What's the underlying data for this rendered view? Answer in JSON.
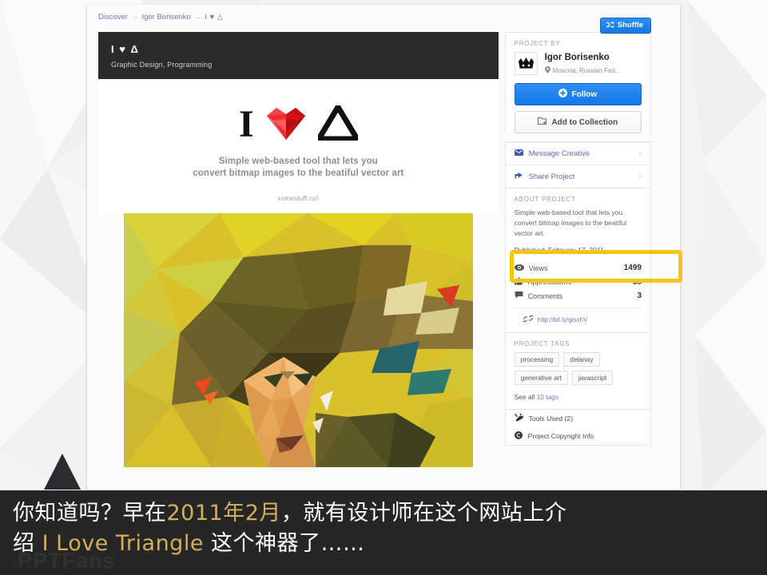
{
  "breadcrumb": {
    "item1": "Discover",
    "sep": "→",
    "item2": "Igor Borisenko",
    "current": "I ♥ △"
  },
  "topbar": {
    "shuffle_label": "Shuffle",
    "shuffle_icon": "shuffle-icon"
  },
  "project": {
    "title": "I ♥ Δ",
    "subtitle": "Graphic Design, Programming"
  },
  "hero": {
    "logo_letter": "I",
    "heart_icon": "faceted-heart-icon",
    "triangle_icon": "triangle-icon",
    "tagline_line1": "Simple web-based tool that lets you",
    "tagline_line2": "convert bitmap images to the beatiful vector art",
    "link": "somestuff.ru/i"
  },
  "sidebar": {
    "project_by_label": "PROJECT BY",
    "author_name": "Igor Borisenko",
    "author_location": "Moscow, Russian Fed...",
    "avatar_icon": "crown-avatar-icon",
    "location_icon": "map-pin-icon",
    "follow_label": "Follow",
    "follow_icon": "plus-circle-icon",
    "collection_label": "Add to Collection",
    "collection_icon": "add-folder-icon",
    "message_label": "Message Creative",
    "message_icon": "envelope-icon",
    "share_label": "Share Project",
    "share_icon": "share-icon",
    "chevron_icon": "chevron-right-icon",
    "about_label": "ABOUT PROJECT",
    "about_line1": "Simple web-based tool that lets you",
    "about_line2": "convert bitmap images to the beatiful",
    "about_line3": "vector art.",
    "published": "Published: February 17, 2011",
    "stats": [
      {
        "label": "Views",
        "value": "1499",
        "icon": "eye-icon"
      },
      {
        "label": "Appreciations",
        "value": "68",
        "icon": "thumbs-up-icon"
      },
      {
        "label": "Comments",
        "value": "3",
        "icon": "comment-icon"
      }
    ],
    "external_link": "http://bit.ly/gisxhV",
    "link_icon": "chain-link-icon",
    "tags_label": "PROJECT TAGS",
    "tags": [
      "processing",
      "delanay",
      "generative art",
      "javascript"
    ],
    "see_all_prefix": "See all ",
    "see_all_link": "10 tags",
    "tools_used": "Tools Used (2)",
    "tools_icon": "tools-icon",
    "copyright": "Project Copyright Info",
    "copyright_icon": "copyright-icon"
  },
  "annotation": {
    "highlight_color": "#f5c518",
    "highlight_target": "published-date"
  },
  "caption": {
    "line1_a": "你知道吗？早在",
    "line1_hl": "2011年2月",
    "line1_b": "，就有设计师在这个网站上介",
    "line2_a": "绍 ",
    "line2_hl": "I Love Triangle",
    "line2_b": " 这个神器了……",
    "highlight_color": "#d4b05a"
  },
  "watermark": {
    "text": "PPTFans"
  }
}
